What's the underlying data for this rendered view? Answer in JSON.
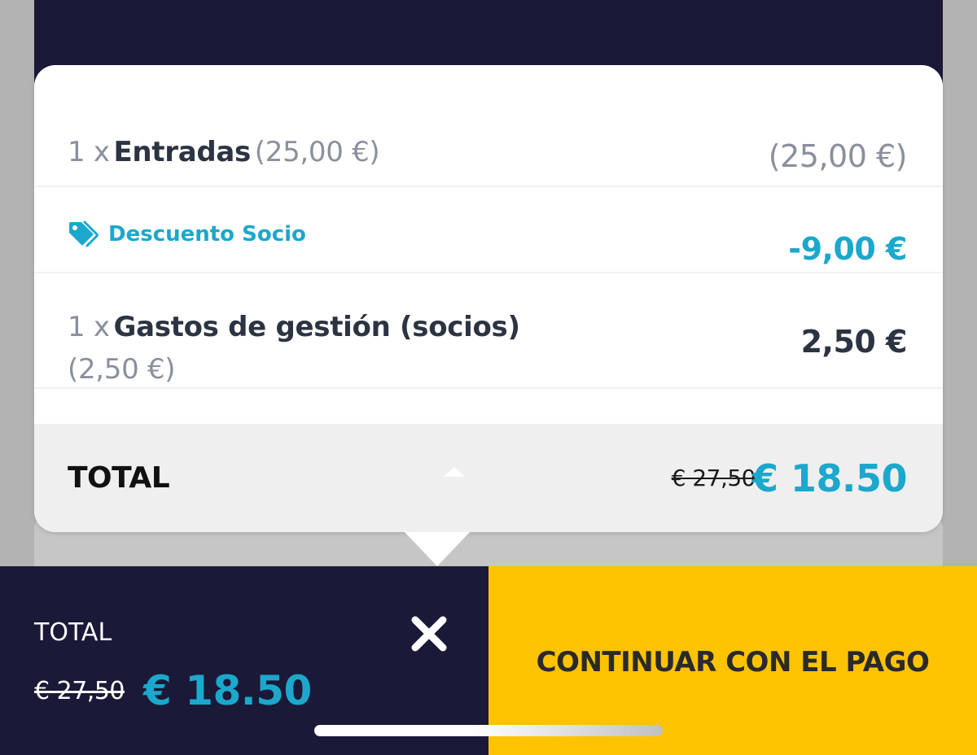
{
  "order": {
    "items": [
      {
        "qty": "1 x",
        "name": "Entradas",
        "unit_price": "(25,00 €)",
        "amount": "(25,00 €)"
      },
      {
        "qty": "1 x",
        "name": "Gastos de gestión (socios)",
        "unit_price": "(2,50 €)",
        "amount": "2,50 €"
      }
    ],
    "discount": {
      "label": "Descuento Socio",
      "amount": "-9,00 €",
      "icon": "tag-icon"
    }
  },
  "summary": {
    "total_label": "TOTAL",
    "old_price": "€ 27,50",
    "new_price": "€ 18.50"
  },
  "footer": {
    "total_label": "TOTAL",
    "old_price": "€ 27,50",
    "new_price": "€ 18.50",
    "close_icon": "close-icon",
    "cta_label": "CONTINUAR CON EL PAGO"
  },
  "colors": {
    "navy": "#1a1937",
    "accent": "#1ba8cc",
    "cta": "#fdc300",
    "text_dark": "#2c3442",
    "text_muted": "#8a8f9c"
  }
}
